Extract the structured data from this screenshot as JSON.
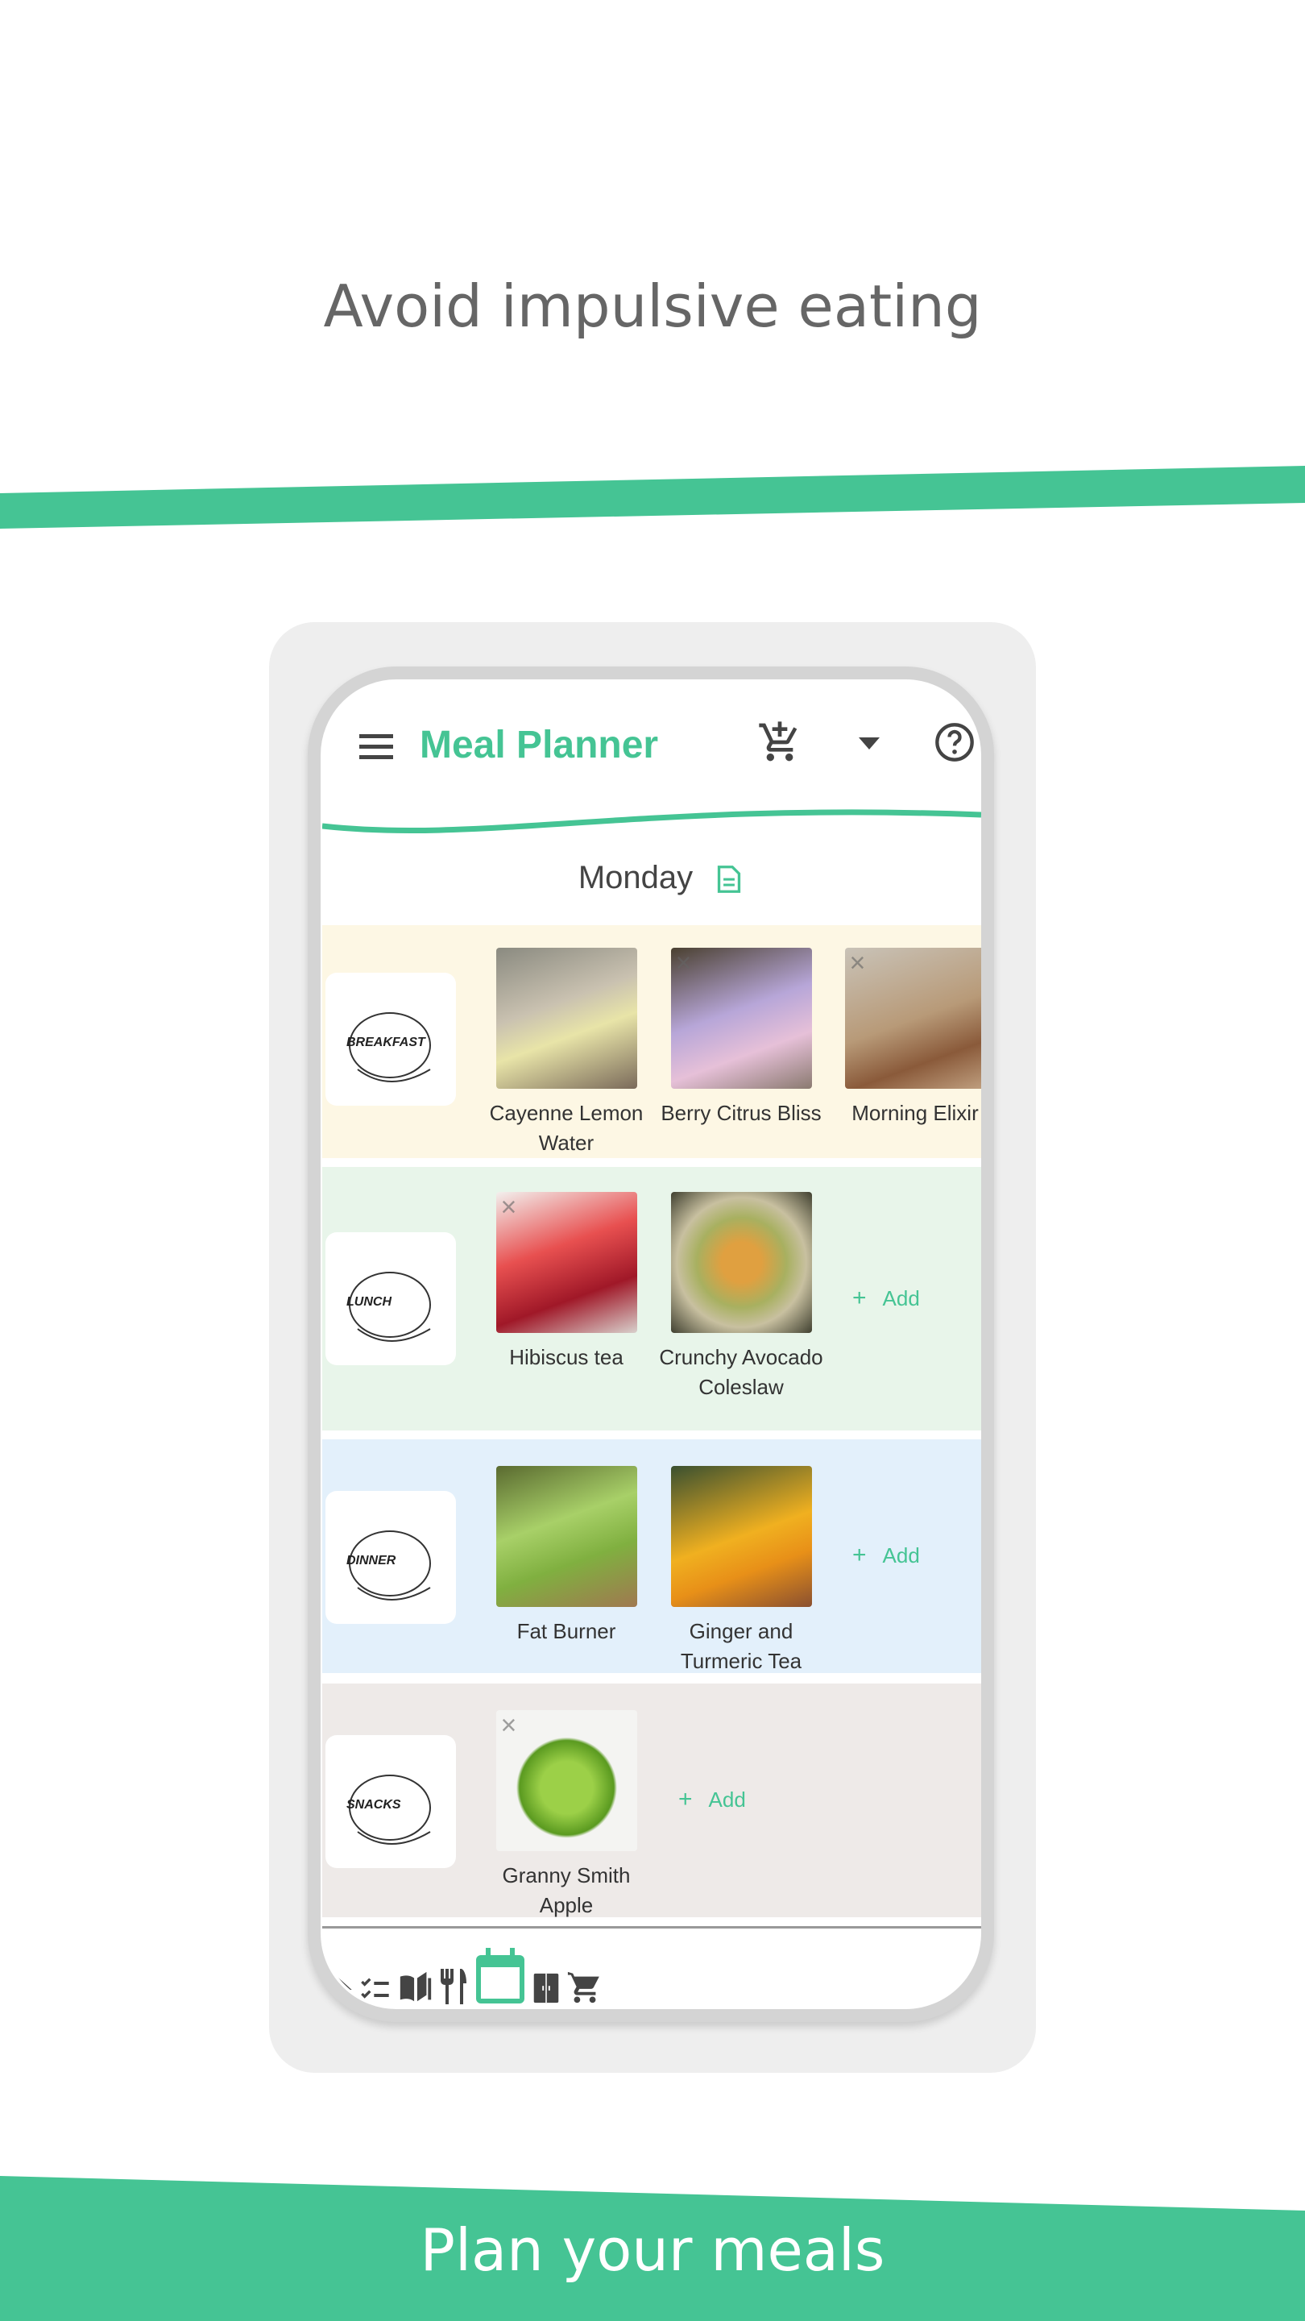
{
  "headline": "Avoid impulsive eating",
  "footer": "Plan your meals",
  "colors": {
    "accent": "#45c494",
    "breakfast_bg": "#fdf7e4",
    "lunch_bg": "#e8f5ea",
    "dinner_bg": "#e3f0fb",
    "snacks_bg": "#eeeae8"
  },
  "app": {
    "title": "Meal Planner",
    "header_icons": [
      "menu-icon",
      "cart-plus-icon",
      "dropdown-icon",
      "help-icon"
    ],
    "day": "Monday",
    "add_label": "Add",
    "meals": [
      {
        "label": "BREAKFAST",
        "items": [
          {
            "name": "Cayenne Lemon Water",
            "close": false
          },
          {
            "name": "Berry Citrus Bliss",
            "close": true
          },
          {
            "name": "Morning Elixir",
            "close": true
          }
        ]
      },
      {
        "label": "LUNCH",
        "items": [
          {
            "name": "Hibiscus tea",
            "close": true
          },
          {
            "name": "Crunchy Avocado Coleslaw",
            "close": false
          }
        ]
      },
      {
        "label": "DINNER",
        "items": [
          {
            "name": "Fat Burner",
            "close": false
          },
          {
            "name": "Ginger and Turmeric Tea",
            "close": false
          }
        ]
      },
      {
        "label": "SNACKS",
        "items": [
          {
            "name": "Granny Smith Apple",
            "close": true
          }
        ]
      }
    ],
    "nav": [
      "home-icon",
      "checklist-icon",
      "recipe-book-icon",
      "fork-knife-icon",
      "calendar-icon",
      "pantry-icon",
      "cart-icon"
    ],
    "nav_active": "calendar-icon"
  }
}
